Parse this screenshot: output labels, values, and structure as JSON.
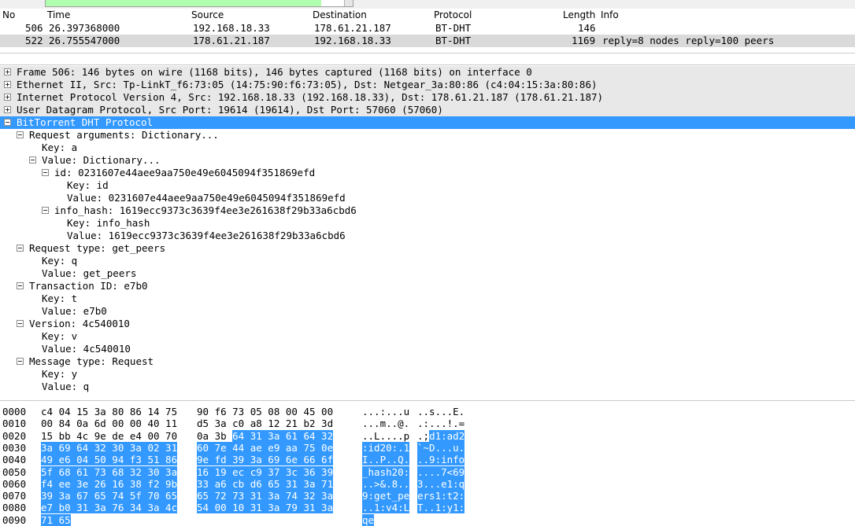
{
  "packet_list": {
    "columns": [
      "No",
      "Time",
      "Source",
      "Destination",
      "Protocol",
      "Length",
      "Info"
    ],
    "rows": [
      {
        "no": "506",
        "time": "26.397368000",
        "source": "192.168.18.33",
        "destination": "178.61.21.187",
        "protocol": "BT-DHT",
        "length": "146",
        "info": ""
      },
      {
        "no": "522",
        "time": "26.755547000",
        "source": "178.61.21.187",
        "destination": "192.168.18.33",
        "protocol": "BT-DHT",
        "length": "1169",
        "info": "reply=8 nodes reply=100 peers"
      }
    ]
  },
  "details": {
    "lines": [
      {
        "text": "Frame 506: 146 bytes on wire (1168 bits), 146 bytes captured (1168 bits) on interface 0",
        "indent": 0,
        "toggle": "plus",
        "style": "proto"
      },
      {
        "text": "Ethernet II, Src: Tp-LinkT_f6:73:05 (14:75:90:f6:73:05), Dst: Netgear_3a:80:86 (c4:04:15:3a:80:86)",
        "indent": 0,
        "toggle": "plus",
        "style": "proto"
      },
      {
        "text": "Internet Protocol Version 4, Src: 192.168.18.33 (192.168.18.33), Dst: 178.61.21.187 (178.61.21.187)",
        "indent": 0,
        "toggle": "plus",
        "style": "proto"
      },
      {
        "text": "User Datagram Protocol, Src Port: 19614 (19614), Dst Port: 57060 (57060)",
        "indent": 0,
        "toggle": "plus",
        "style": "proto"
      },
      {
        "text": "BitTorrent DHT Protocol",
        "indent": 0,
        "toggle": "minus",
        "style": "sel"
      },
      {
        "text": "Request arguments: Dictionary...",
        "indent": 1,
        "toggle": "minus",
        "style": ""
      },
      {
        "text": "Key: a",
        "indent": 2,
        "toggle": "",
        "style": ""
      },
      {
        "text": "Value: Dictionary...",
        "indent": 2,
        "toggle": "minus",
        "style": ""
      },
      {
        "text": "id: 0231607e44aee9aa750e49e6045094f351869efd",
        "indent": 3,
        "toggle": "minus",
        "style": ""
      },
      {
        "text": "Key: id",
        "indent": 4,
        "toggle": "",
        "style": ""
      },
      {
        "text": "Value: 0231607e44aee9aa750e49e6045094f351869efd",
        "indent": 4,
        "toggle": "",
        "style": ""
      },
      {
        "text": "info_hash: 1619ecc9373c3639f4ee3e261638f29b33a6cbd6",
        "indent": 3,
        "toggle": "minus",
        "style": ""
      },
      {
        "text": "Key: info_hash",
        "indent": 4,
        "toggle": "",
        "style": ""
      },
      {
        "text": "Value: 1619ecc9373c3639f4ee3e261638f29b33a6cbd6",
        "indent": 4,
        "toggle": "",
        "style": ""
      },
      {
        "text": "Request type: get_peers",
        "indent": 1,
        "toggle": "minus",
        "style": ""
      },
      {
        "text": "Key: q",
        "indent": 2,
        "toggle": "",
        "style": ""
      },
      {
        "text": "Value: get_peers",
        "indent": 2,
        "toggle": "",
        "style": ""
      },
      {
        "text": "Transaction ID: e7b0",
        "indent": 1,
        "toggle": "minus",
        "style": ""
      },
      {
        "text": "Key: t",
        "indent": 2,
        "toggle": "",
        "style": ""
      },
      {
        "text": "Value: e7b0",
        "indent": 2,
        "toggle": "",
        "style": ""
      },
      {
        "text": "Version: 4c540010",
        "indent": 1,
        "toggle": "minus",
        "style": ""
      },
      {
        "text": "Key: v",
        "indent": 2,
        "toggle": "",
        "style": ""
      },
      {
        "text": "Value: 4c540010",
        "indent": 2,
        "toggle": "",
        "style": ""
      },
      {
        "text": "Message type: Request",
        "indent": 1,
        "toggle": "minus",
        "style": ""
      },
      {
        "text": "Key: y",
        "indent": 2,
        "toggle": "",
        "style": ""
      },
      {
        "text": "Value: q",
        "indent": 2,
        "toggle": "",
        "style": ""
      }
    ]
  },
  "hex": {
    "rows": [
      {
        "offset": "0000",
        "h1": "c4 04 15 3a 80 86 14 75",
        "h2": "90 f6 73 05 08 00 45 00",
        "a1": "...:...u",
        "a2": "..s...E.",
        "hl_from": -1
      },
      {
        "offset": "0010",
        "h1": "00 84 0a 6d 00 00 40 11",
        "h2": "d5 3a c0 a8 12 21 b2 3d",
        "a1": "...m..@.",
        "a2": ".:...!.=",
        "hl_from": -1
      },
      {
        "offset": "0020",
        "h1": "15 bb 4c 9e de e4 00 70",
        "h2": "0a 3b 64 31 3a 61 64 32",
        "a1": "..L....p",
        ".a2": "",
        "a2": ".;d1:ad2",
        "hl_from": 10
      },
      {
        "offset": "0030",
        "h1": "3a 69 64 32 30 3a 02 31",
        "h2": "60 7e 44 ae e9 aa 75 0e",
        "a1": ":id20:.1",
        "a2": "`~D...u.",
        "hl_from": 0
      },
      {
        "offset": "0040",
        "h1": "49 e6 04 50 94 f3 51 86",
        "h2": "9e fd 39 3a 69 6e 66 6f",
        "a1": "I..P..Q.",
        "a2": "..9:info",
        "hl_from": 0
      },
      {
        "offset": "0050",
        "h1": "5f 68 61 73 68 32 30 3a",
        "h2": "16 19 ec c9 37 3c 36 39",
        "a1": "_hash20:",
        "a2": "....7<69",
        "hl_from": 0
      },
      {
        "offset": "0060",
        "h1": "f4 ee 3e 26 16 38 f2 9b",
        "h2": "33 a6 cb d6 65 31 3a 71",
        "a1": "..>&.8..",
        "a2": "3...e1:q",
        "hl_from": 0
      },
      {
        "offset": "0070",
        "h1": "39 3a 67 65 74 5f 70 65",
        "h2": "65 72 73 31 3a 74 32 3a",
        "a1": "9:get_pe",
        "a2": "ers1:t2:",
        "hl_from": 0
      },
      {
        "offset": "0080",
        "h1": "e7 b0 31 3a 76 34 3a 4c",
        "h2": "54 00 10 31 3a 79 31 3a",
        "a1": "..1:v4:L",
        "a2": "T..1:y1:",
        "hl_from": 0
      },
      {
        "offset": "0090",
        "h1": "71 65",
        "h2": "",
        "a1": "qe",
        "a2": "",
        "hl_from": 0
      }
    ]
  }
}
